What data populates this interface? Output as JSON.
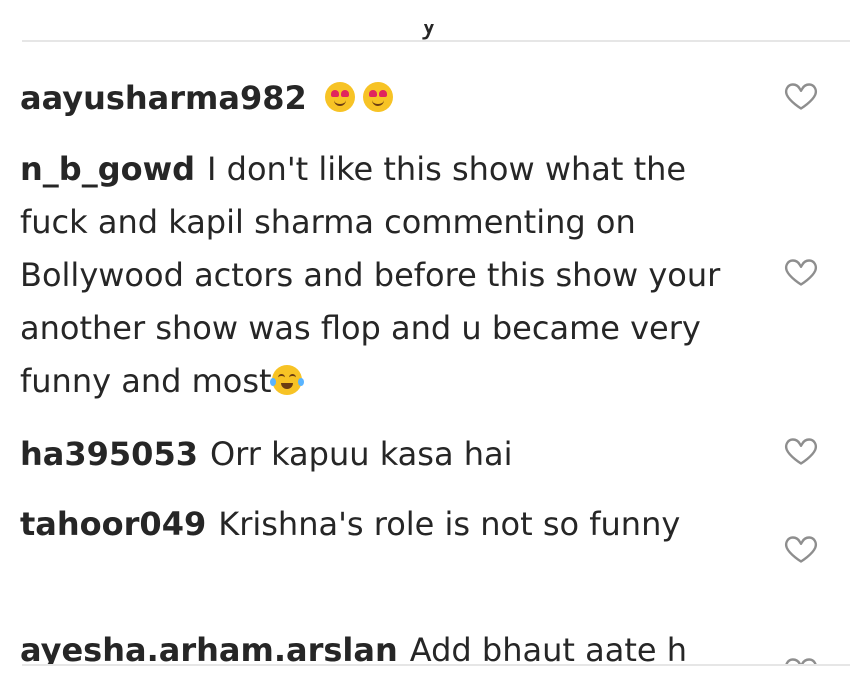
{
  "comments": [
    {
      "username": "aayusharma982",
      "text": "",
      "emojis": [
        "heart-eyes-emoji",
        "heart-eyes-emoji"
      ]
    },
    {
      "username": "n_b_gowd",
      "text": "I don't like this show what the fuck and kapil sharma commenting on Bollywood actors and before this show your another show was flop and u became very funny and most",
      "emojis": [
        "joy-emoji"
      ]
    },
    {
      "username": "ha395053",
      "text": "Orr kapuu kasa hai"
    },
    {
      "username": "tahoor049",
      "text": "Krishna's role is not so funny"
    },
    {
      "username": "ayesha.arham.arslan",
      "text": "Add bhaut aate h"
    }
  ],
  "icons": {
    "like": "heart-outline-icon"
  },
  "colors": {
    "text": "#262626",
    "icon_stroke": "#8e8e8e",
    "divider": "#e6e6e6",
    "emoji_face": "#f7c325"
  }
}
